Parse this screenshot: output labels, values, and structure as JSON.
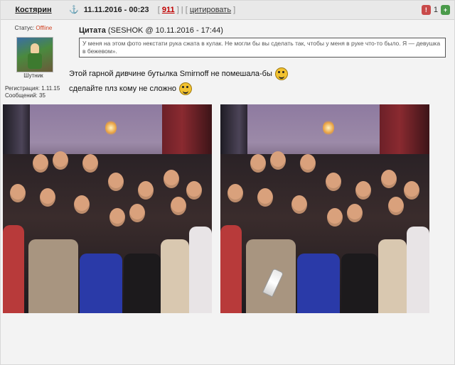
{
  "post": {
    "author": "Костярин",
    "status_label": "Статус:",
    "status_value": "Offline",
    "rank": "Шутник",
    "registration": "Регистрация: 1.11.15",
    "messages": "Сообщений: 35",
    "anchor_icon": "⚓",
    "datetime": "11.11.2016 - 00:23",
    "post_number": "911",
    "quote_link": "цитировать",
    "rating_value": "1",
    "rating_minus": "!",
    "rating_plus": "+"
  },
  "quote": {
    "title": "Цитата",
    "source": "(SESHOK @ 10.11.2016 - 17:44)",
    "text": "У меня на этом фото некстати рука сжата в кулак. Не могли бы вы сделать так, чтобы у меня в руке что-то было. Я — девушка в бежевом»."
  },
  "message": {
    "line1": "Этой гарной дивчине бутылка Smirnoff не помешала-бы",
    "line2": "сделайте плз кому не сложно"
  },
  "colors": {
    "offline": "#d04020",
    "post_number": "#c00000",
    "rating_minus": "#c94a4a",
    "rating_plus": "#4a9a4a"
  },
  "icons": [
    "anchor-icon",
    "rating-minus-icon",
    "rating-plus-icon",
    "smiley-icon"
  ]
}
